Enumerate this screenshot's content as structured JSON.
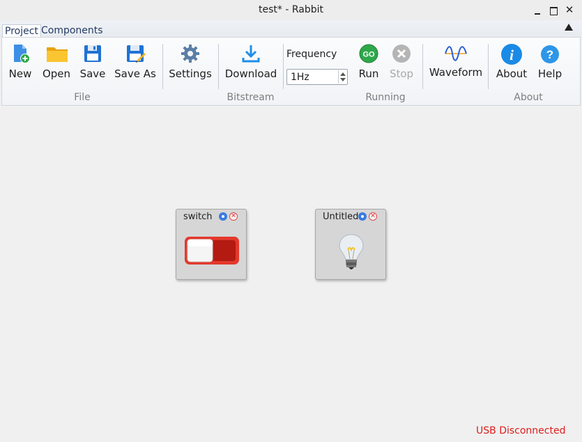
{
  "window": {
    "title": "test* - Rabbit",
    "minimize_glyph": "",
    "close_glyph": "✕"
  },
  "tabs": [
    {
      "label": "Project",
      "active": true
    },
    {
      "label": "Components",
      "active": false
    }
  ],
  "ribbon": {
    "buttons": {
      "new": {
        "label": "New",
        "icon": "new-file-icon"
      },
      "open": {
        "label": "Open",
        "icon": "folder-icon"
      },
      "save": {
        "label": "Save",
        "icon": "floppy-disk-icon"
      },
      "save_as": {
        "label": "Save As",
        "icon": "floppy-pencil-icon"
      },
      "settings": {
        "label": "Settings",
        "icon": "gear-icon"
      },
      "download": {
        "label": "Download",
        "icon": "download-arrow-icon"
      },
      "run": {
        "label": "Run",
        "icon": "go-icon",
        "icon_text": "GO"
      },
      "stop": {
        "label": "Stop",
        "icon": "stop-x-icon",
        "disabled": true
      },
      "waveform": {
        "label": "Waveform",
        "icon": "sine-wave-icon"
      },
      "about": {
        "label": "About",
        "icon": "info-icon",
        "icon_text": "i"
      },
      "help": {
        "label": "Help",
        "icon": "question-icon",
        "icon_text": "?"
      }
    },
    "frequency": {
      "label": "Frequency",
      "value": "1Hz"
    },
    "groups": {
      "file": "File",
      "bitstream": "Bitstream",
      "running": "Running",
      "about": "About"
    }
  },
  "components": [
    {
      "title": "switch",
      "icon": "toggle-switch-icon"
    },
    {
      "title": "Untitled",
      "icon": "light-bulb-icon"
    }
  ],
  "status": {
    "text": "USB Disconnected",
    "color": "#e01b1b"
  },
  "colors": {
    "accent_blue": "#3a7be0",
    "go_green": "#2ea84a",
    "switch_red": "#e2392c",
    "error_red": "#e04848"
  }
}
